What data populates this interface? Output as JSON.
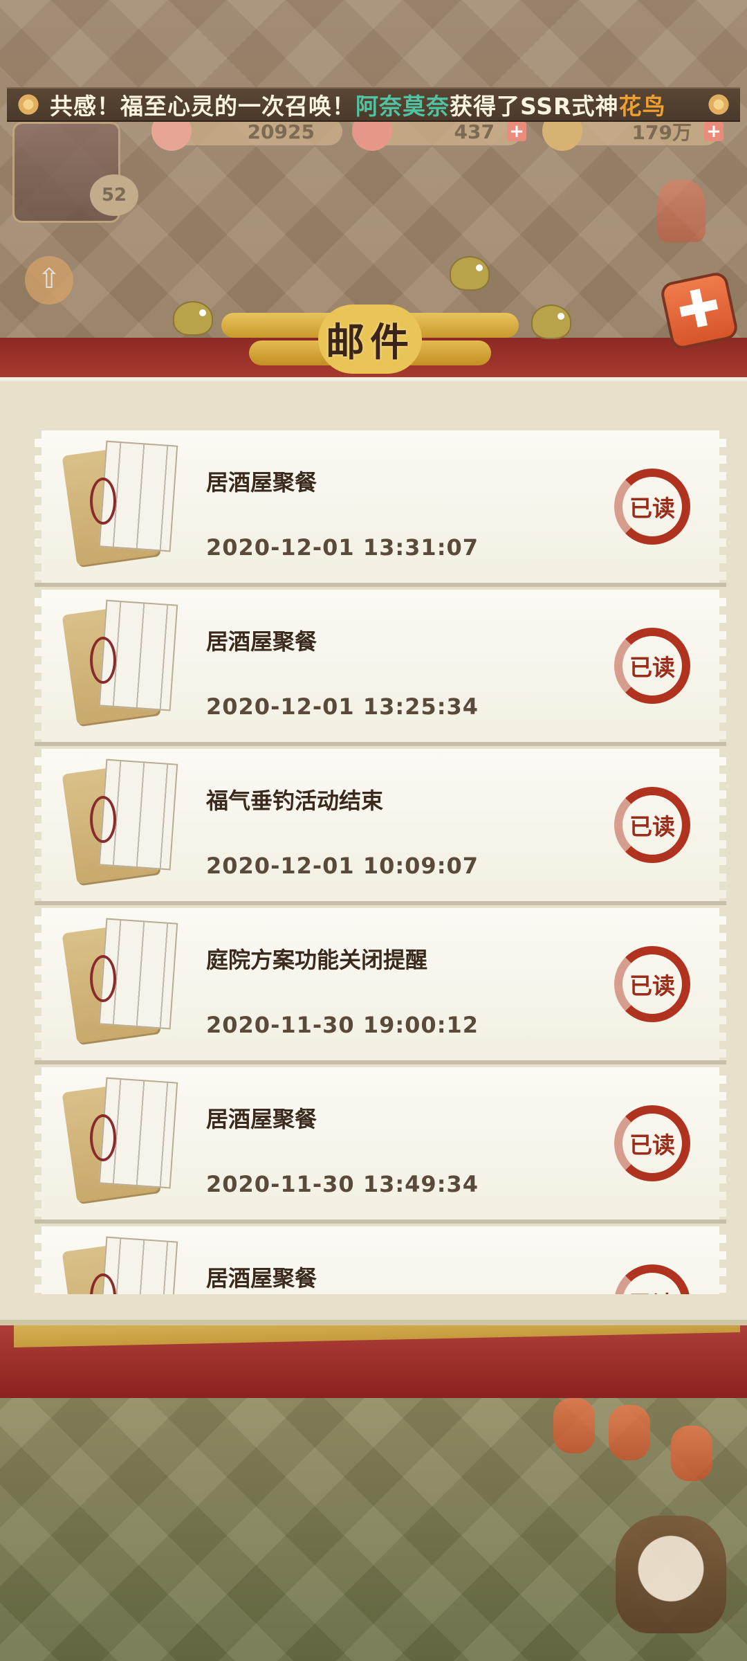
{
  "hud": {
    "marquee": {
      "prefix": "共感！福至心灵的一次召唤！",
      "player": "阿奈莫奈",
      "middle": "获得了SSR式神",
      "shikigami": "花鸟"
    },
    "resources": [
      {
        "value": "20925"
      },
      {
        "value": "437"
      },
      {
        "value": "179万"
      }
    ],
    "level": "52"
  },
  "mail_panel": {
    "title": "邮件",
    "items": [
      {
        "title": "居酒屋聚餐",
        "date": "2020-12-01 13:31:07",
        "status": "已读"
      },
      {
        "title": "居酒屋聚餐",
        "date": "2020-12-01 13:25:34",
        "status": "已读"
      },
      {
        "title": "福气垂钓活动结束",
        "date": "2020-12-01 10:09:07",
        "status": "已读"
      },
      {
        "title": "庭院方案功能关闭提醒",
        "date": "2020-11-30 19:00:12",
        "status": "已读"
      },
      {
        "title": "居酒屋聚餐",
        "date": "2020-11-30 13:49:34",
        "status": "已读"
      },
      {
        "title": "居酒屋聚餐",
        "date": "",
        "status": "已读"
      }
    ]
  },
  "colors": {
    "accent_red": "#b0331f",
    "banner_red": "#9c2f28",
    "gold": "#d8b259",
    "highlight_green": "#4fc3a2",
    "highlight_orange": "#f0a030"
  },
  "icons": [
    "flower-icon",
    "gem-icon",
    "magatama-icon",
    "coin-icon",
    "plus-icon",
    "close-icon",
    "level-up-icon",
    "fish-icon",
    "mail-envelope-icon",
    "read-stamp-icon"
  ]
}
